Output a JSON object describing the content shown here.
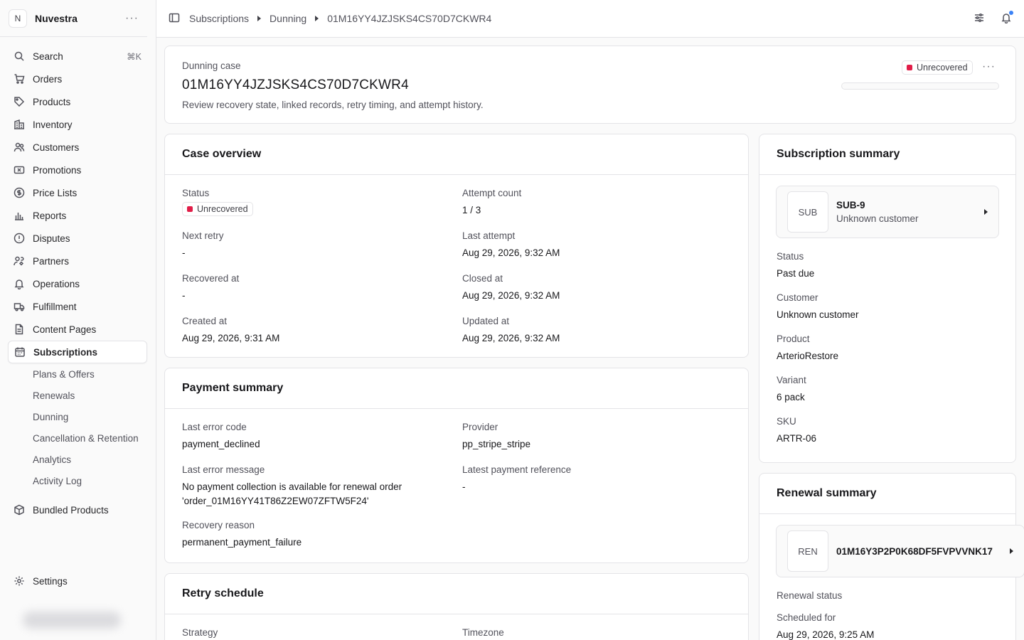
{
  "store": {
    "initial": "N",
    "name": "Nuvestra"
  },
  "nav": {
    "search": {
      "label": "Search",
      "shortcut": "⌘K"
    },
    "items": [
      {
        "label": "Orders",
        "icon": "orders-icon"
      },
      {
        "label": "Products",
        "icon": "tag-icon"
      },
      {
        "label": "Inventory",
        "icon": "building-icon"
      },
      {
        "label": "Customers",
        "icon": "users-icon"
      },
      {
        "label": "Promotions",
        "icon": "ticket-icon"
      },
      {
        "label": "Price Lists",
        "icon": "dollar-icon"
      },
      {
        "label": "Reports",
        "icon": "chart-icon"
      },
      {
        "label": "Disputes",
        "icon": "alert-icon"
      },
      {
        "label": "Partners",
        "icon": "partners-icon"
      },
      {
        "label": "Operations",
        "icon": "bell-icon"
      },
      {
        "label": "Fulfillment",
        "icon": "truck-icon"
      },
      {
        "label": "Content Pages",
        "icon": "document-icon"
      },
      {
        "label": "Subscriptions",
        "icon": "calendar-icon"
      }
    ],
    "sub_items": [
      "Plans & Offers",
      "Renewals",
      "Dunning",
      "Cancellation & Retention",
      "Analytics",
      "Activity Log"
    ],
    "bundled": "Bundled Products",
    "settings": "Settings"
  },
  "breadcrumb": [
    "Subscriptions",
    "Dunning",
    "01M16YY4JZJSKS4CS70D7CKWR4"
  ],
  "header": {
    "eyebrow": "Dunning case",
    "title": "01M16YY4JZJSKS4CS70D7CKWR4",
    "description": "Review recovery state, linked records, retry timing, and attempt history.",
    "status": "Unrecovered"
  },
  "case_overview": {
    "title": "Case overview",
    "status_label": "Status",
    "status_value": "Unrecovered",
    "attempt_count_label": "Attempt count",
    "attempt_count_value": "1 / 3",
    "next_retry_label": "Next retry",
    "next_retry_value": "-",
    "last_attempt_label": "Last attempt",
    "last_attempt_value": "Aug 29, 2026, 9:32 AM",
    "recovered_at_label": "Recovered at",
    "recovered_at_value": "-",
    "closed_at_label": "Closed at",
    "closed_at_value": "Aug 29, 2026, 9:32 AM",
    "created_at_label": "Created at",
    "created_at_value": "Aug 29, 2026, 9:31 AM",
    "updated_at_label": "Updated at",
    "updated_at_value": "Aug 29, 2026, 9:32 AM"
  },
  "payment_summary": {
    "title": "Payment summary",
    "last_error_code_label": "Last error code",
    "last_error_code_value": "payment_declined",
    "provider_label": "Provider",
    "provider_value": "pp_stripe_stripe",
    "last_error_message_label": "Last error message",
    "last_error_message_value": "No payment collection is available for renewal order 'order_01M16YY41T86Z2EW07ZFTW5F24'",
    "latest_payment_reference_label": "Latest payment reference",
    "latest_payment_reference_value": "-",
    "recovery_reason_label": "Recovery reason",
    "recovery_reason_value": "permanent_payment_failure"
  },
  "retry_schedule": {
    "title": "Retry schedule",
    "strategy_label": "Strategy",
    "timezone_label": "Timezone"
  },
  "subscription_summary": {
    "title": "Subscription summary",
    "thumb": "SUB",
    "id": "SUB-9",
    "customer_line": "Unknown customer",
    "status_label": "Status",
    "status_value": "Past due",
    "customer_label": "Customer",
    "customer_value": "Unknown customer",
    "product_label": "Product",
    "product_value": "ArterioRestore",
    "variant_label": "Variant",
    "variant_value": "6 pack",
    "sku_label": "SKU",
    "sku_value": "ARTR-06"
  },
  "renewal_summary": {
    "title": "Renewal summary",
    "thumb": "REN",
    "id": "01M16Y3P2P0K68DF5FVPVVNK17",
    "renewal_status_label": "Renewal status",
    "scheduled_for_label": "Scheduled for",
    "scheduled_for_value": "Aug 29, 2026, 9:25 AM"
  },
  "colors": {
    "unrecovered": "#e11d48",
    "notification_dot": "#3b82f6"
  }
}
